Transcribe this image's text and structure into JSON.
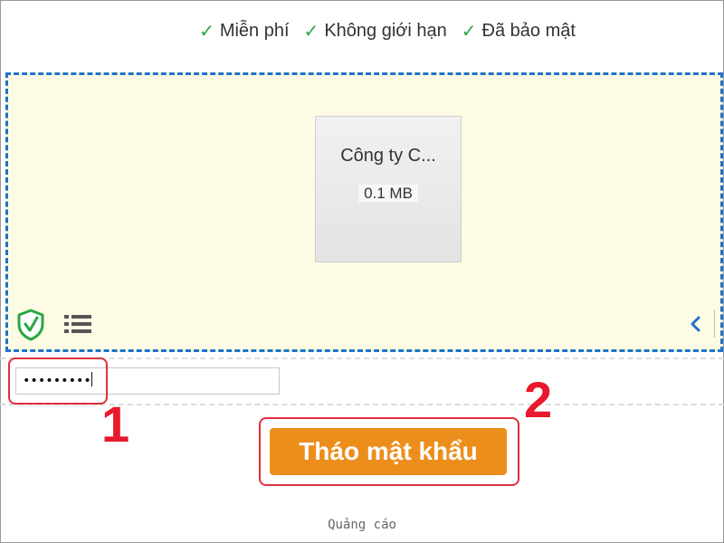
{
  "features": [
    {
      "icon": "check-icon",
      "label": "Miễn phí"
    },
    {
      "icon": "check-icon",
      "label": "Không giới hạn"
    },
    {
      "icon": "check-icon",
      "label": "Đã bảo mật"
    }
  ],
  "file": {
    "name": "Công ty C...",
    "size": "0.1 MB"
  },
  "toolbar": {
    "left_icons": [
      "shield-check-icon",
      "list-icon"
    ],
    "right_icons": [
      "chevron-left-icon"
    ]
  },
  "password": {
    "value": "•••••••••"
  },
  "annotations": {
    "step1": "1",
    "step2": "2"
  },
  "unlock_button": {
    "label": "Tháo mật khẩu"
  },
  "ad_label": "Quảng cáo",
  "colors": {
    "accent_button": "#ec8e1c",
    "check": "#28a745",
    "drop_border": "#1e73c8",
    "drop_background": "#fdfbe4",
    "annotation_red": "#e8192c",
    "shield": "#28a745"
  }
}
